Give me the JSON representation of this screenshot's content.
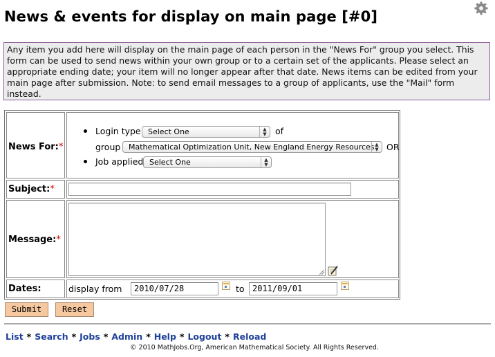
{
  "page": {
    "title": "News & events for display on main page [#0]",
    "intro": "Any item you add here will display on the main page of each person in the \"News For\" group you select. This form can be used to send news within your own group or to a certain set of the applicants. Please select an appropriate ending date; your item will no longer appear after that date. News items can be edited from your main page after submission. Note: to send email messages to a group of applicants, use the \"Mail\" form instead."
  },
  "form": {
    "required_mark": "*",
    "news_for": {
      "label": "News For:",
      "login_type_label": "Login type",
      "login_type_value": "Select One",
      "of_text": "of",
      "group_label": "group",
      "group_value": "Mathematical Optimization Unit, New England Energy Resources",
      "or_text": "OR",
      "job_applied_label": "Job applied",
      "job_applied_value": "Select One"
    },
    "subject": {
      "label": "Subject:",
      "value": ""
    },
    "message": {
      "label": "Message:",
      "value": ""
    },
    "dates": {
      "label": "Dates:",
      "display_from_label": "display from",
      "from_value": "2010/07/28",
      "to_label": "to",
      "to_value": "2011/09/01"
    },
    "submit_label": "Submit",
    "reset_label": "Reset"
  },
  "nav": {
    "items": [
      "List",
      "Search",
      "Jobs",
      "Admin",
      "Help",
      "Logout",
      "Reload"
    ],
    "separator": "*"
  },
  "footer": {
    "copyright": "© 2010 MathJobs.Org, American Mathematical Society. All Rights Reserved."
  },
  "icons": {
    "settings": "gear-icon",
    "calendar": "calendar-icon",
    "edit": "edit-pencil-icon"
  }
}
